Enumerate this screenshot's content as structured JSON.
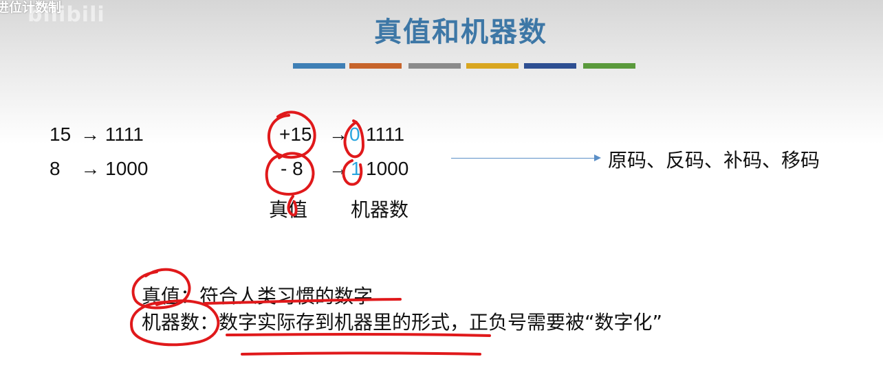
{
  "video": {
    "corner_title": "进位计数制",
    "watermark": "bilibili"
  },
  "slide": {
    "title": "真值和机器数",
    "color_bars": [
      "#3f7fb5",
      "#c7642b",
      "#8b8b8b",
      "#d9a620",
      "#2e4f92",
      "#5a9a3c"
    ],
    "left_examples": [
      {
        "decimal": "15",
        "arrow": "→",
        "binary": "1111"
      },
      {
        "decimal": "8",
        "arrow": "→",
        "binary": "1000"
      }
    ],
    "signed_examples": [
      {
        "true_value": "+15",
        "arrow": "→",
        "sign_bit": "0",
        "magnitude": "1111"
      },
      {
        "true_value": "- 8",
        "arrow": "→",
        "sign_bit": "1",
        "magnitude": "1000"
      }
    ],
    "label_true_value": "真值",
    "label_machine_number": "机器数",
    "encodings": "原码、反码、补码、移码",
    "definitions": [
      {
        "term": "真值",
        "sep": "：",
        "text": "符合人类习惯的数字"
      },
      {
        "term": "机器数",
        "sep": "：",
        "text": "数字实际存到机器里的形式，正负号需要被“数字化”"
      }
    ],
    "accent_colors": {
      "title": "#3d77a6",
      "sign_bit": "#2aa6df",
      "annotation_ink": "#e0191b",
      "arrow": "#5b8fc7"
    }
  }
}
